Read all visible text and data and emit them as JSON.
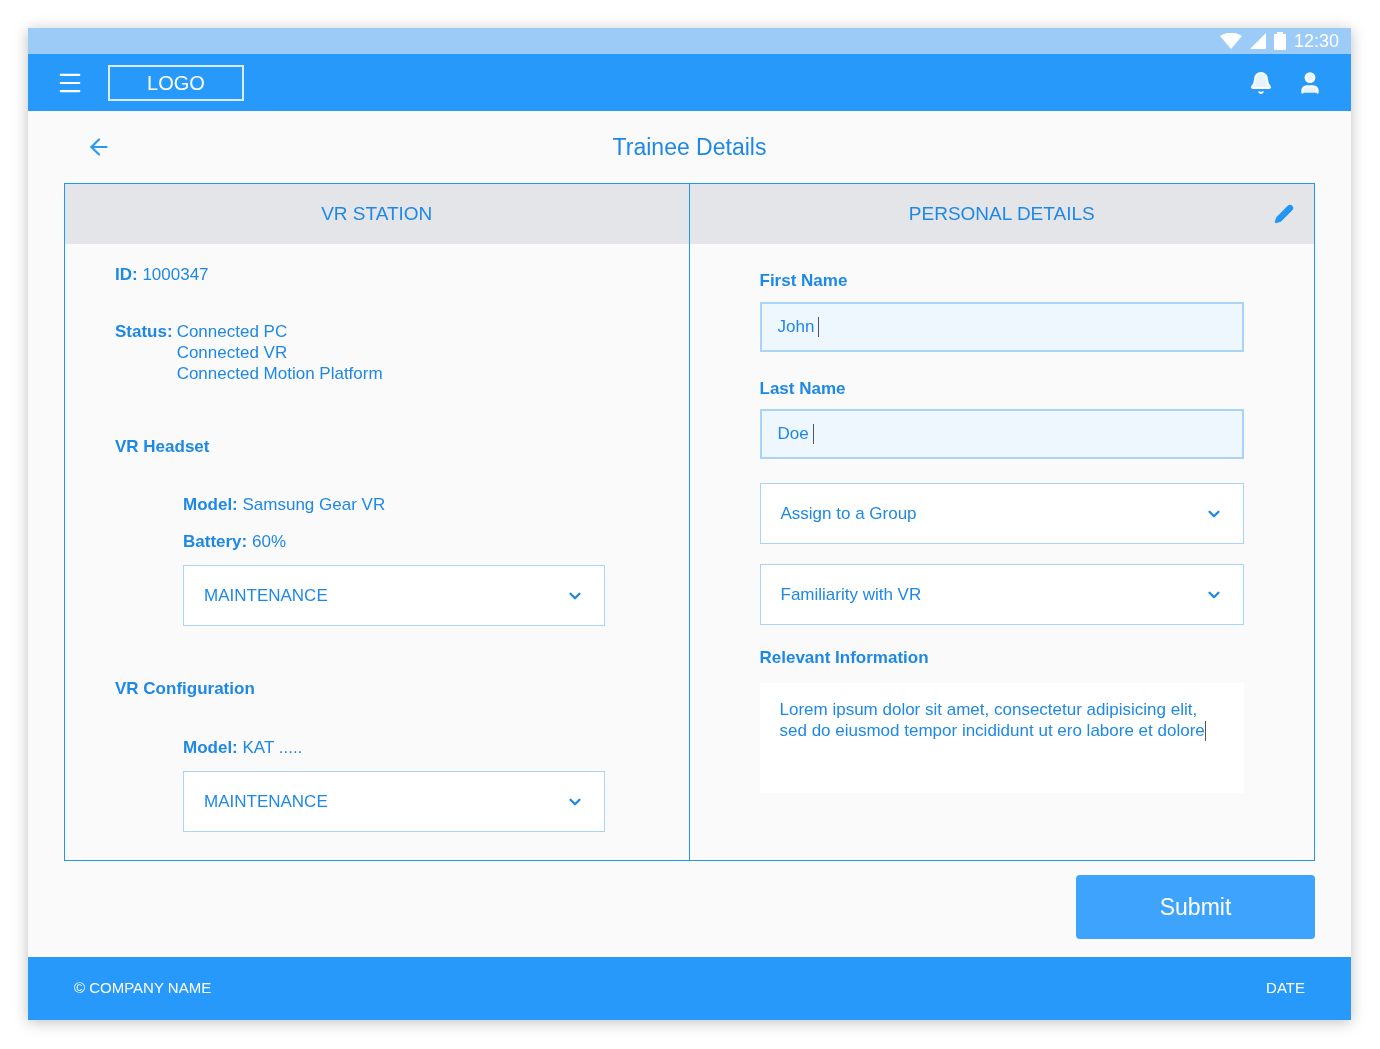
{
  "status_bar": {
    "time": "12:30"
  },
  "header": {
    "logo": "LOGO"
  },
  "page": {
    "title": "Trainee Details"
  },
  "vr_station": {
    "heading": "VR STATION",
    "id": "**ID:** 1000347",
    "status_label": "Status:",
    "status_values": [
      "Connected PC",
      "Connected VR",
      "Connected Motion Platform"
    ],
    "sections": [
      {
        "heading": "VR Headset",
        "details": [
          "**Model:** Samsung Gear VR",
          "**Battery:** 60%"
        ],
        "select": "MAINTENANCE"
      },
      {
        "heading": "VR Configuration",
        "details": [
          "**Model:** KAT ....."
        ],
        "select": "MAINTENANCE"
      }
    ]
  },
  "personal_details": {
    "heading": "PERSONAL DETAILS",
    "fields": [
      {
        "kind": "text",
        "label": "First Name",
        "value": "John"
      },
      {
        "kind": "text",
        "label": "Last Name",
        "value": "Doe"
      },
      {
        "kind": "select",
        "placeholder": "Assign to a Group"
      },
      {
        "kind": "select",
        "placeholder": "Familiarity with VR"
      },
      {
        "kind": "textarea",
        "label": "Relevant Information",
        "value": "Lorem ipsum dolor sit amet, consectetur adipisicing elit, sed do eiusmod tempor incididunt ut ero labore et dolore"
      }
    ]
  },
  "submit": "Submit",
  "footer": {
    "company": "© COMPANY NAME",
    "date": "DATE"
  }
}
